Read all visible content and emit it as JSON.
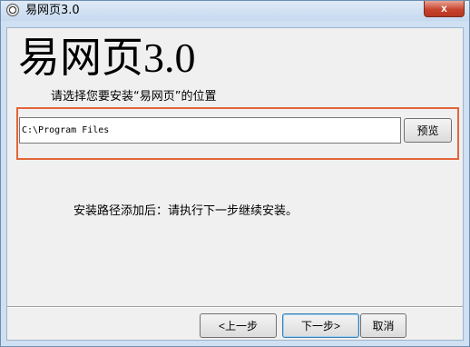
{
  "window": {
    "title": "易网页3.0",
    "close_symbol": "x",
    "icons": {
      "app": "app-icon",
      "close": "close-icon"
    }
  },
  "main": {
    "big_title": "易网页3.0",
    "prompt_label": "请选择您要安装“易网页”的位置",
    "install_path": "C:\\Program Files",
    "browse_label": "预览",
    "hint_text": "安装路径添加后：请执行下一步继续安装。"
  },
  "footer": {
    "prev_label": "<上一步",
    "next_label": "下一步>",
    "cancel_label": "取消"
  },
  "colors": {
    "highlight_border": "#e2653a",
    "close_button": "#c7452f"
  }
}
